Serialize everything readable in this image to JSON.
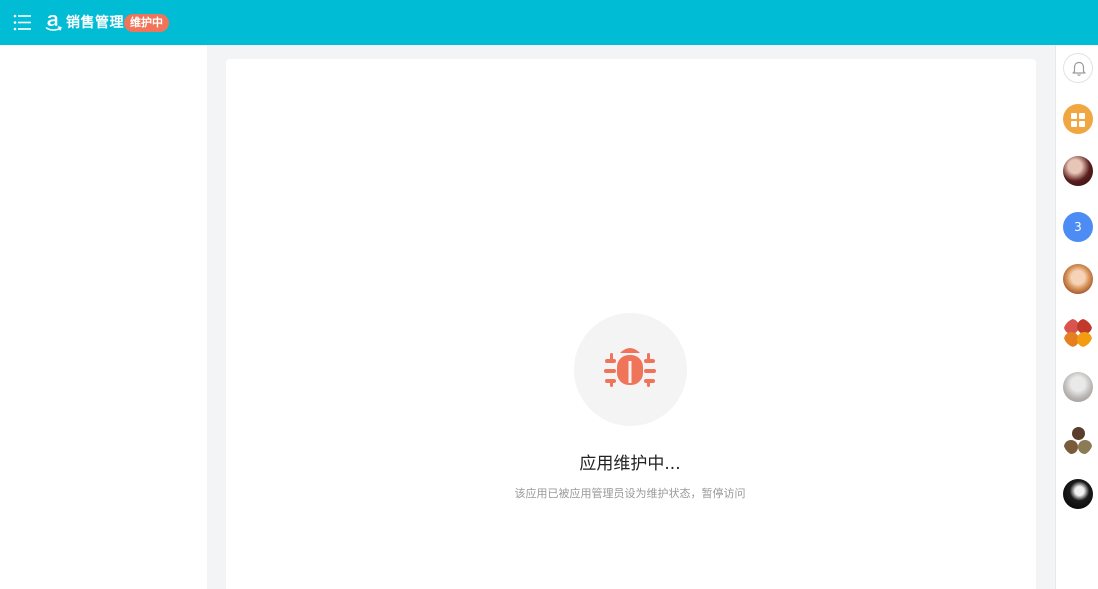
{
  "header": {
    "app_title": "销售管理",
    "status_badge": "维护中",
    "menu_icon": "menu-list-icon",
    "logo_icon": "amazon-logo-icon"
  },
  "main": {
    "bug_icon": "bug-icon",
    "title": "应用维护中...",
    "description": "该应用已被应用管理员设为维护状态，暂停访问"
  },
  "right_rail": {
    "notification_icon": "bell-icon",
    "apps_icon": "grid-apps-icon",
    "count_avatar_label": "3"
  },
  "colors": {
    "header_bg": "#00bcd4",
    "badge_bg": "#f0745a",
    "bug_color": "#f0745a",
    "apps_btn": "#f0a742",
    "count_avatar": "#4d8cf5"
  }
}
